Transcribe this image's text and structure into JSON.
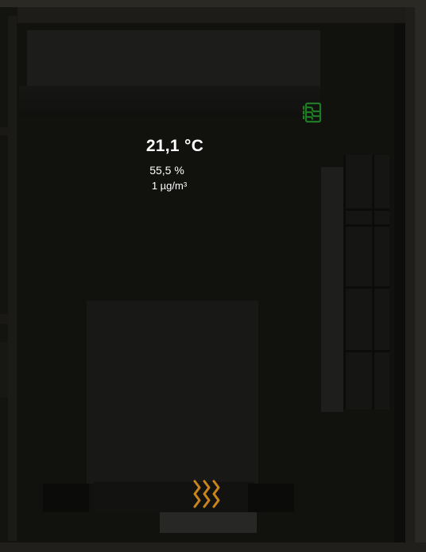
{
  "sensor": {
    "temperature": "21,1 °C",
    "humidity": "55,5 %",
    "pm25": "1 µg/m³"
  },
  "icons": {
    "air_purifier": "air-filter-icon",
    "heater": "radiator-heat-icon"
  },
  "colors": {
    "air_purifier_active": "#1f7a24",
    "heater_active": "#c8861a"
  }
}
